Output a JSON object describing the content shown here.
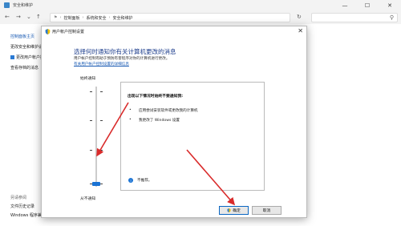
{
  "background_window": {
    "title": "安全和维护",
    "breadcrumb": [
      "控制面板",
      "系统和安全",
      "安全和维护"
    ],
    "left_nav": [
      {
        "label": "控制面板主页",
        "style": "link"
      },
      {
        "label": "更改安全和维护设置",
        "style": "dark"
      },
      {
        "label": "更改用户帐户控制设置",
        "style": "dark",
        "icon": "shield-icon"
      },
      {
        "label": "查看存档的消息",
        "style": "dark"
      }
    ],
    "see_also": {
      "heading": "另请参阅",
      "items": [
        "文件历史记录",
        "Windows 程序兼容性疑难解答"
      ]
    }
  },
  "dialog": {
    "title": "用户帐户控制设置",
    "heading": "选择何时通知你有关计算机更改的消息",
    "description": "用户帐户控制有助于预防有害程序对你的计算机进行更改。",
    "link": "有关用户帐户控制设置的详细信息",
    "slider": {
      "top_label": "始终通知",
      "bottom_label": "从不通知",
      "levels": 4,
      "selected_level": 1
    },
    "info": {
      "title": "出现以下情况时始终不要通知我:",
      "bullets": [
        "应用尝试安装软件或更改我的计算机",
        "我更改了 Windows 设置"
      ],
      "note": "不推荐。"
    },
    "buttons": {
      "ok": "确定",
      "cancel": "取消"
    }
  },
  "colors": {
    "accent": "#1a73d4",
    "arrow": "#d92b2b",
    "heading": "#1c3d8c"
  }
}
